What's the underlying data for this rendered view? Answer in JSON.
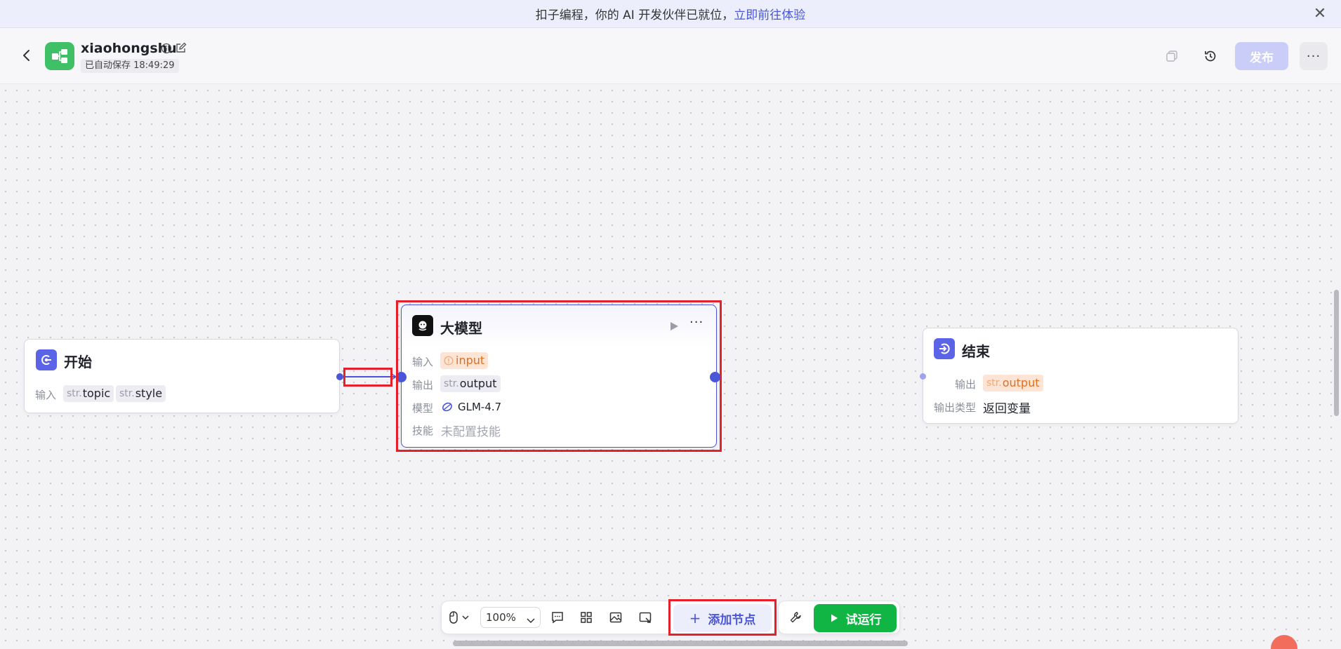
{
  "announcement": {
    "text": "扣子编程，你的 AI 开发伙伴已就位，",
    "link": "立即前往体验"
  },
  "header": {
    "app_name": "xiaohongshu",
    "autosave": "已自动保存 18:49:29",
    "publish_label": "发布"
  },
  "nodes": {
    "start": {
      "title": "开始",
      "input_label": "输入",
      "params": [
        {
          "prefix": "str.",
          "name": "topic"
        },
        {
          "prefix": "str.",
          "name": "style"
        }
      ]
    },
    "llm": {
      "title": "大模型",
      "input_label": "输入",
      "input_value": "input",
      "output_label": "输出",
      "output_prefix": "str.",
      "output_value": "output",
      "model_label": "模型",
      "model_value": "GLM-4.7",
      "skill_label": "技能",
      "skill_value": "未配置技能"
    },
    "end": {
      "title": "结束",
      "output_label": "输出",
      "output_prefix": "str.",
      "output_value": "output",
      "output_type_label": "输出类型",
      "output_type_value": "返回变量"
    }
  },
  "toolbar": {
    "zoom": "100%",
    "add_node_label": "添加节点",
    "try_run_label": "试运行"
  },
  "colors": {
    "accent": "#4a55d8",
    "run_green": "#11b544",
    "warn_orange": "#e0701f",
    "highlight_red": "#e5202a"
  }
}
